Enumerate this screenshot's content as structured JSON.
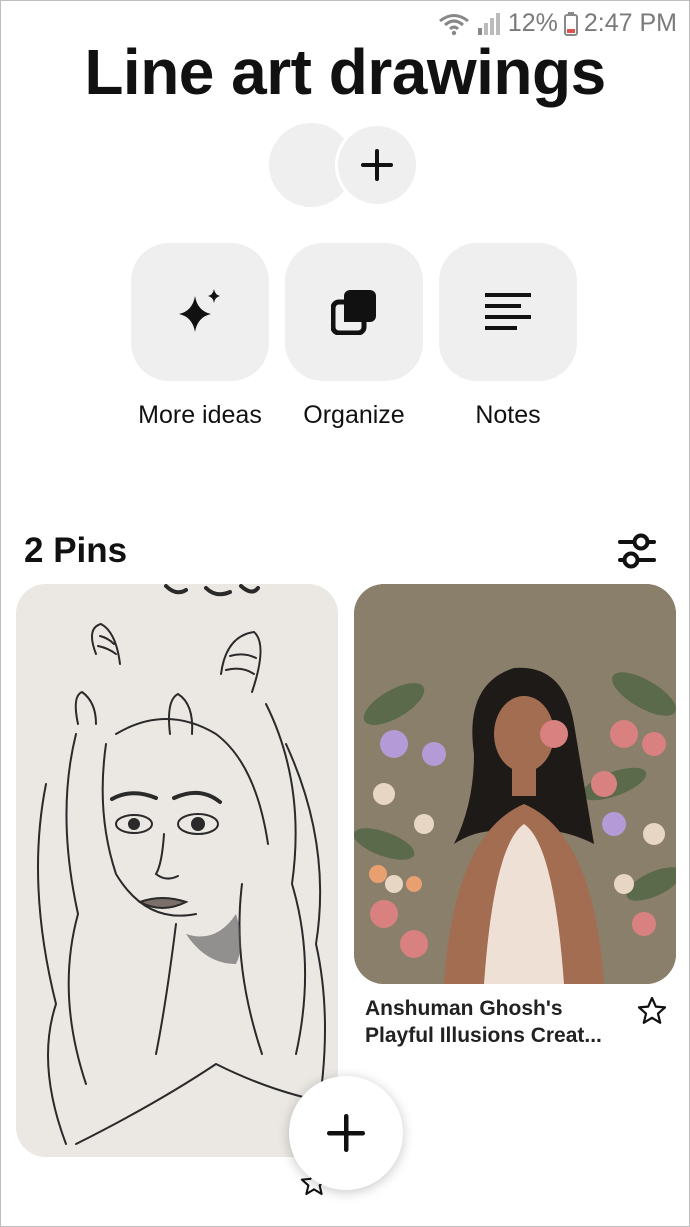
{
  "status_bar": {
    "battery": "12%",
    "time": "2:47 PM"
  },
  "board": {
    "title": "Line art drawings"
  },
  "collaborators": {
    "add_icon": "plus-icon"
  },
  "actions": [
    {
      "label": "More ideas",
      "icon": "sparkle-icon"
    },
    {
      "label": "Organize",
      "icon": "organize-icon"
    },
    {
      "label": "Notes",
      "icon": "notes-icon"
    }
  ],
  "pins_section": {
    "count_label": "2 Pins",
    "filter_icon": "sliders-icon"
  },
  "pins": [
    {
      "image": "line-art-horned-girl-sketch"
    },
    {
      "image": "illustration-woman-with-flowers",
      "title_line1": "Anshuman Ghosh's",
      "title_line2": "Playful Illusions Creat..."
    }
  ],
  "fab": {
    "icon": "plus-icon"
  },
  "colors": {
    "tile_bg": "#efefef",
    "text": "#111111",
    "status_gray": "#7a7a7a"
  }
}
